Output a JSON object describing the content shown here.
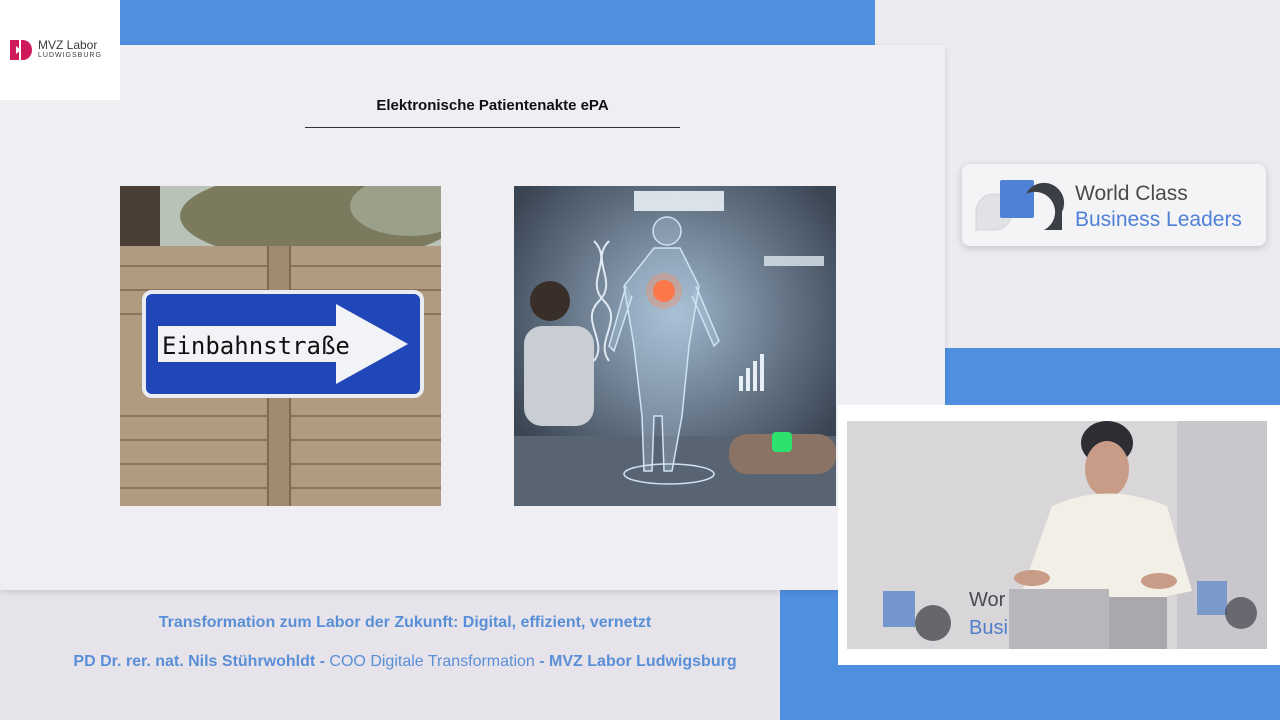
{
  "logo": {
    "line1": "MVZ Labor",
    "line2": "LUDWIGSBURG",
    "mark_color": "#d0195a"
  },
  "slide": {
    "title": "Elektronische Patientenakte ePA",
    "left_image": {
      "sign_text": "Einbahnstraße",
      "icon": "one-way-arrow-sign"
    },
    "right_image": {
      "icon": "digital-human-hologram"
    }
  },
  "brand": {
    "line1": "World Class",
    "line2": "Business Leaders",
    "accent_color": "#4f82d6"
  },
  "video": {
    "backdrop_line1": "Wor",
    "backdrop_line2": "Busi"
  },
  "caption": {
    "title": "Transformation zum Labor der Zukunft: Digital, effizient, vernetzt",
    "speaker_name": "PD Dr. rer. nat. Nils Stührwohldt",
    "sep1": " - ",
    "speaker_role": "COO Digitale Transformation",
    "sep2": " - ",
    "org": "MVZ Labor Ludwigsburg",
    "color": "#5a8fd8"
  },
  "colors": {
    "blue_block": "#4f8fe0",
    "slide_bg": "#efeef3"
  }
}
